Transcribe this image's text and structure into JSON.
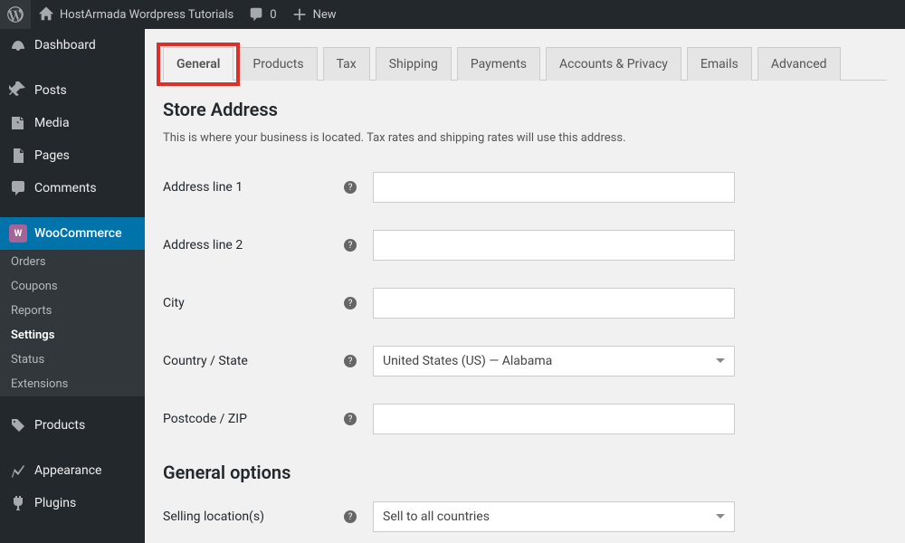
{
  "topbar": {
    "site_title": "HostArmada Wordpress Tutorials",
    "comments_count": "0",
    "new_label": "New"
  },
  "sidebar": {
    "items": [
      {
        "label": "Dashboard"
      },
      {
        "label": "Posts"
      },
      {
        "label": "Media"
      },
      {
        "label": "Pages"
      },
      {
        "label": "Comments"
      },
      {
        "label": "WooCommerce"
      },
      {
        "label": "Products"
      },
      {
        "label": "Appearance"
      },
      {
        "label": "Plugins"
      }
    ],
    "woo_sub": [
      {
        "label": "Orders"
      },
      {
        "label": "Coupons"
      },
      {
        "label": "Reports"
      },
      {
        "label": "Settings"
      },
      {
        "label": "Status"
      },
      {
        "label": "Extensions"
      }
    ]
  },
  "tabs": [
    {
      "label": "General"
    },
    {
      "label": "Products"
    },
    {
      "label": "Tax"
    },
    {
      "label": "Shipping"
    },
    {
      "label": "Payments"
    },
    {
      "label": "Accounts & Privacy"
    },
    {
      "label": "Emails"
    },
    {
      "label": "Advanced"
    }
  ],
  "section": {
    "title": "Store Address",
    "desc": "This is where your business is located. Tax rates and shipping rates will use this address.",
    "addr1_label": "Address line 1",
    "addr2_label": "Address line 2",
    "city_label": "City",
    "country_label": "Country / State",
    "country_value": "United States (US) — Alabama",
    "postcode_label": "Postcode / ZIP"
  },
  "section2": {
    "title": "General options",
    "selling_label": "Selling location(s)",
    "selling_value": "Sell to all countries"
  }
}
